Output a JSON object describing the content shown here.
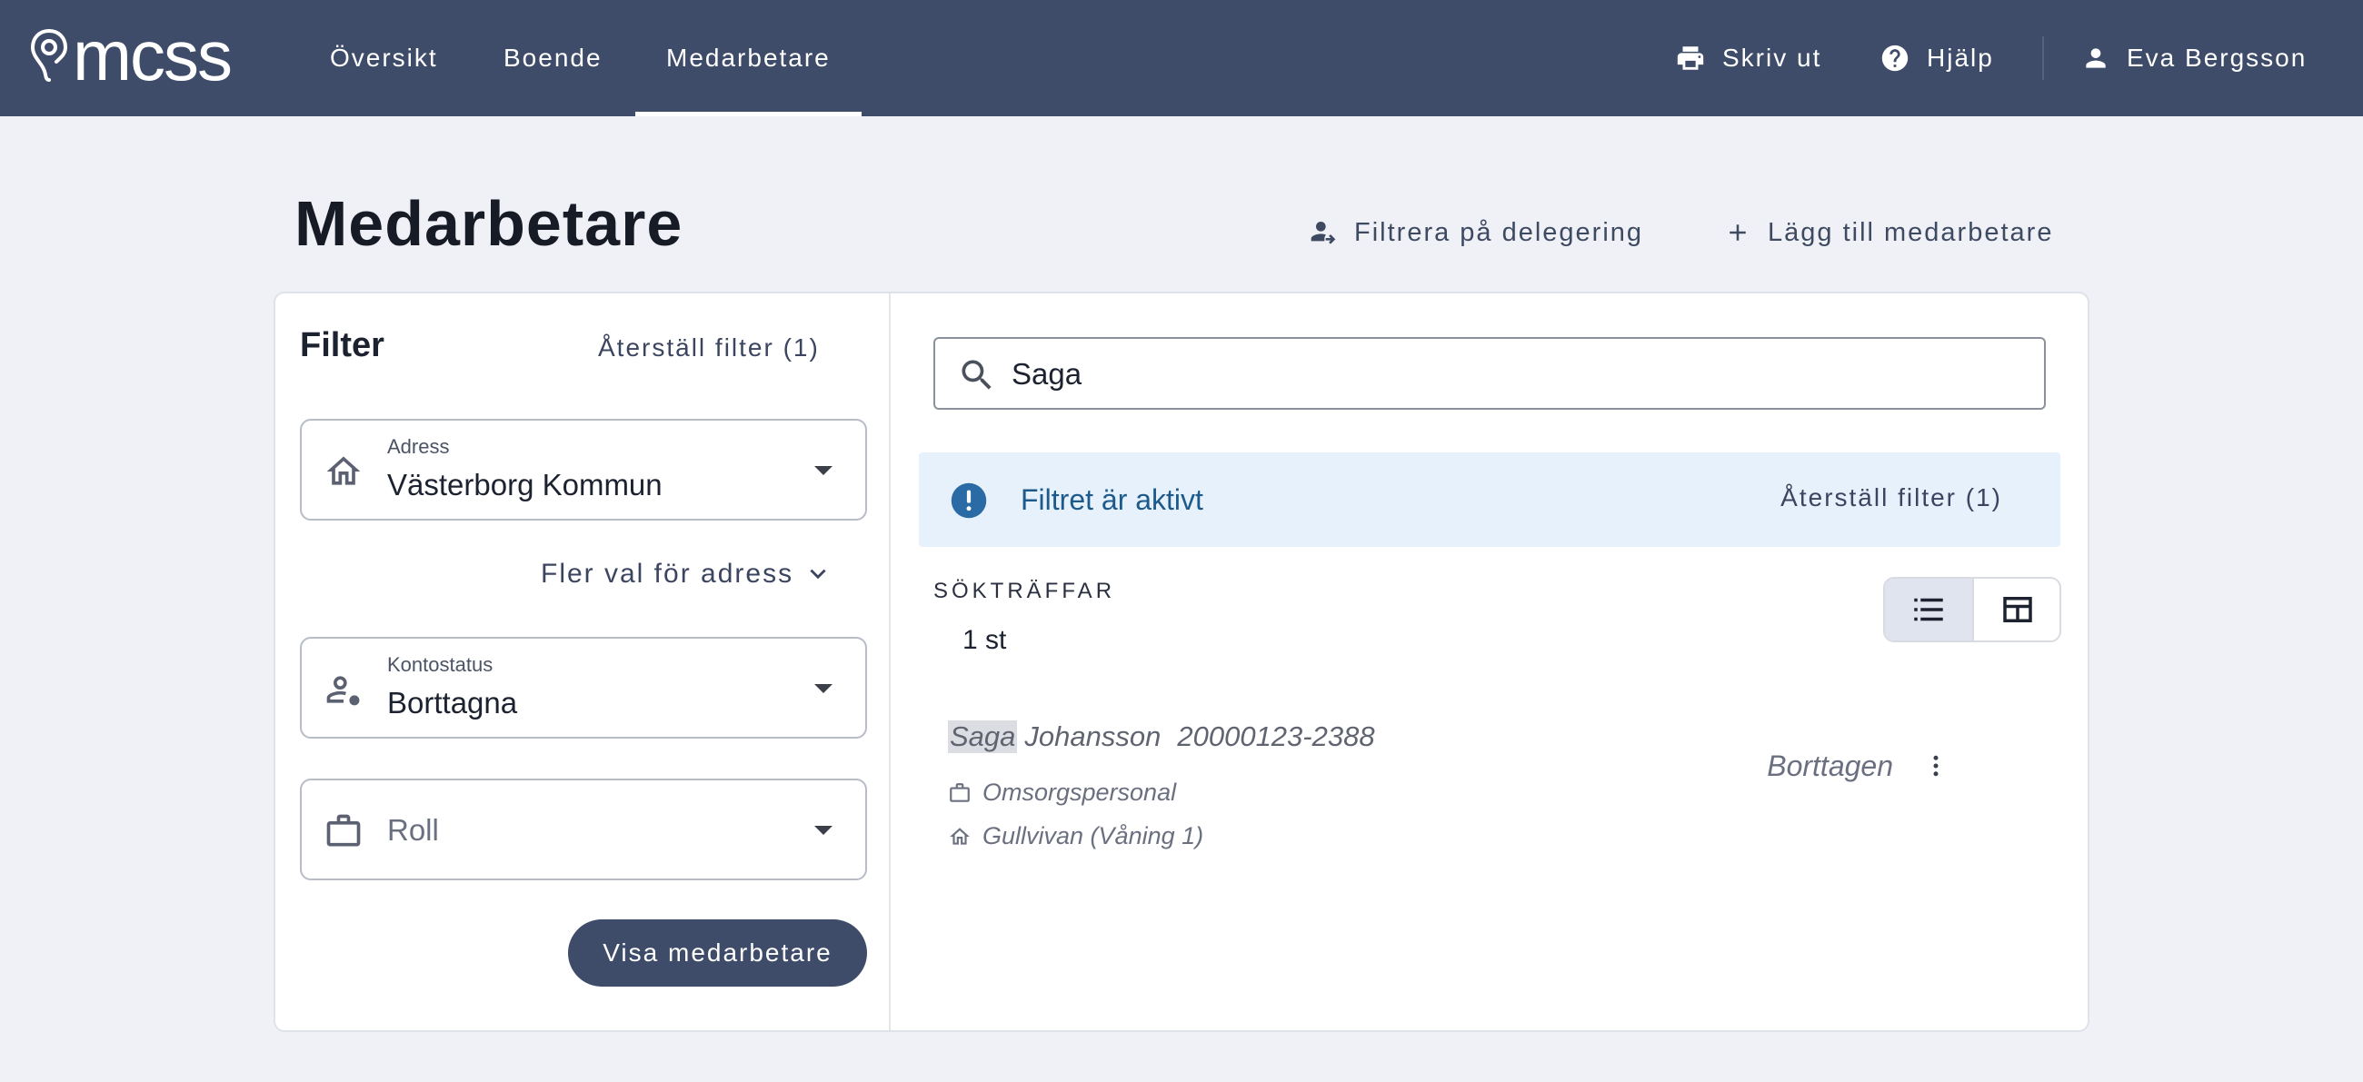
{
  "app": {
    "logo_text": "mcss",
    "nav": [
      {
        "label": "Översikt"
      },
      {
        "label": "Boende"
      },
      {
        "label": "Medarbetare",
        "active": true
      }
    ],
    "actions": {
      "print_label": "Skriv ut",
      "help_label": "Hjälp",
      "user_name": "Eva Bergsson"
    }
  },
  "page": {
    "title": "Medarbetare",
    "filter_delegation_label": "Filtrera på delegering",
    "add_employee_label": "Lägg till medarbetare"
  },
  "filter": {
    "title": "Filter",
    "reset_label": "Återställ filter (1)",
    "address": {
      "label": "Adress",
      "value": "Västerborg Kommun"
    },
    "more_address_label": "Fler val för adress",
    "account_status": {
      "label": "Kontostatus",
      "value": "Borttagna"
    },
    "role": {
      "placeholder": "Roll"
    },
    "submit_label": "Visa medarbetare"
  },
  "results": {
    "search_value": "Saga",
    "alert_text": "Filtret är aktivt",
    "alert_reset_label": "Återställ filter (1)",
    "hits_label": "SÖKTRÄFFAR",
    "hits_count": "1 st",
    "items": [
      {
        "first_name_match": "Saga",
        "last_name": "Johansson",
        "personal_number": "20000123-2388",
        "role": "Omsorgspersonal",
        "location": "Gullvivan (Våning 1)",
        "status": "Borttagen"
      }
    ]
  },
  "colors": {
    "topbar": "#3e4c69",
    "background": "#eff1f6",
    "alert_bg": "#e7f1fb",
    "alert_icon": "#2a6ba6"
  },
  "icons": [
    "location-pin-logo-icon",
    "printer-icon",
    "help-icon",
    "user-icon",
    "person-delegation-icon",
    "plus-icon",
    "home-icon",
    "person-status-icon",
    "briefcase-icon",
    "chevron-down-icon",
    "search-icon",
    "info-icon",
    "list-view-icon",
    "table-view-icon",
    "more-vertical-icon"
  ]
}
